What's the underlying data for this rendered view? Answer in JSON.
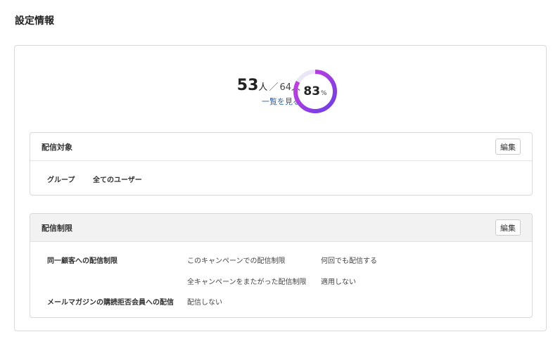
{
  "page": {
    "title": "設定情報"
  },
  "summary": {
    "count": "53",
    "count_unit": "人",
    "separator": "／",
    "total": "64人",
    "view_link": "一覧を見る",
    "percent_value": "83",
    "percent_sign": "%",
    "percent_fraction": 0.83,
    "ring_color_start": "#6a3ee8",
    "ring_color_end": "#d13ee0",
    "ring_track_color": "#ebe6f5"
  },
  "delivery_target": {
    "title": "配信対象",
    "edit_label": "編集",
    "group_label": "グループ",
    "group_value": "全てのユーザー"
  },
  "delivery_limit": {
    "title": "配信制限",
    "edit_label": "編集",
    "same_customer_label": "同一顧客への配信制限",
    "campaign_limit_label": "このキャンペーンでの配信制限",
    "campaign_limit_value": "何回でも配信する",
    "cross_campaign_label": "全キャンペーンをまたがった配信制限",
    "cross_campaign_value": "適用しない",
    "optout_label": "メールマガジンの購読拒否会員への配信",
    "optout_value": "配信しない"
  }
}
